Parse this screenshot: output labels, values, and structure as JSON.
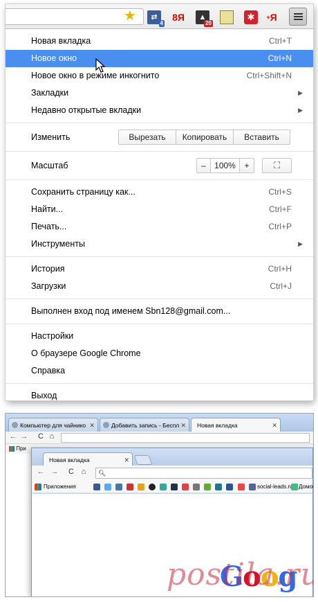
{
  "menu": {
    "items_top": [
      {
        "label": "Новая вкладка",
        "shortcut": "Ctrl+T"
      },
      {
        "label": "Новое окно",
        "shortcut": "Ctrl+N"
      },
      {
        "label": "Новое окно в режиме инкогнито",
        "shortcut": "Ctrl+Shift+N"
      },
      {
        "label": "Закладки",
        "shortcut": ""
      },
      {
        "label": "Недавно открытые вкладки",
        "shortcut": ""
      }
    ],
    "edit": {
      "label": "Изменить",
      "cut": "Вырезать",
      "copy": "Копировать",
      "paste": "Вставить"
    },
    "zoom": {
      "label": "Масштаб",
      "minus": "–",
      "value": "100%",
      "plus": "+"
    },
    "items_page": [
      {
        "label": "Сохранить страницу как...",
        "shortcut": "Ctrl+S"
      },
      {
        "label": "Найти...",
        "shortcut": "Ctrl+F"
      },
      {
        "label": "Печать...",
        "shortcut": "Ctrl+P"
      },
      {
        "label": "Инструменты",
        "shortcut": ""
      }
    ],
    "items_history": [
      {
        "label": "История",
        "shortcut": "Ctrl+H"
      },
      {
        "label": "Загрузки",
        "shortcut": "Ctrl+J"
      }
    ],
    "signed_in": "Выполнен вход под именем Sbn128@gmail.com...",
    "items_settings": [
      {
        "label": "Настройки"
      },
      {
        "label": "О браузере Google Chrome"
      },
      {
        "label": "Справка"
      }
    ],
    "exit": "Выход",
    "highlighted_index": 1
  },
  "toolbar": {
    "badges": {
      "translate": "4",
      "monitor": "20"
    },
    "ya_label": "8Я",
    "ya2_label": "Я"
  },
  "browser_bg": {
    "tabs": [
      "Компьютер для чайнико",
      "Добавить запись - Беспл",
      "Новая вкладка"
    ],
    "bookmarks_label": "При"
  },
  "browser_fg": {
    "tab": "Новая вкладка",
    "bookmarks": {
      "apps": "Приложения",
      "social": "social-leads.ru",
      "home": "Домой"
    }
  },
  "watermark": "postila.ru",
  "logo_text": "Goog"
}
